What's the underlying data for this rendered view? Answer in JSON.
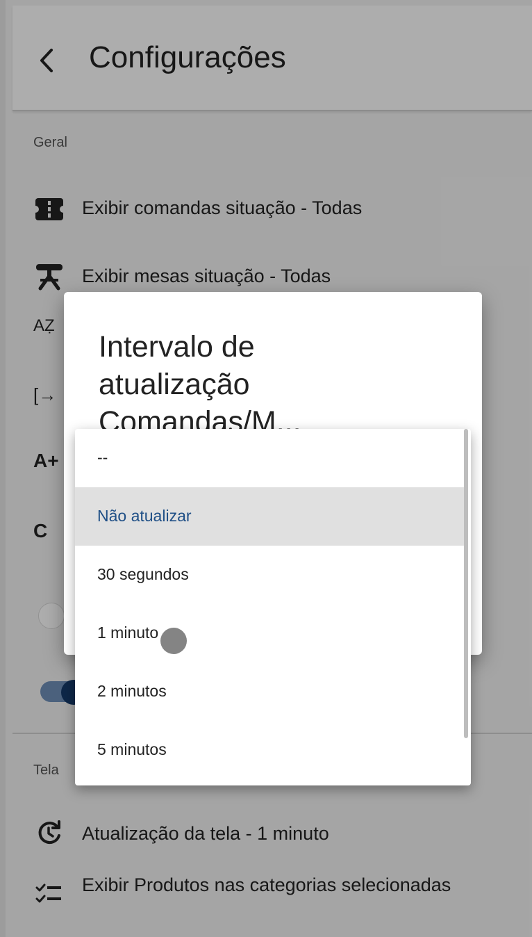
{
  "header": {
    "title": "Configurações"
  },
  "sections": {
    "geral": {
      "label": "Geral",
      "items": [
        {
          "icon": "ticket-icon",
          "label": "Exibir comandas situação - Todas"
        },
        {
          "icon": "table-icon",
          "label": "Exibir mesas situação - Todas"
        }
      ],
      "partially_hidden": {
        "sort_icon_text": "AẒ",
        "logout_icon_text": "[→",
        "font_icon_text": "A+",
        "refresh_icon_text": "C"
      }
    },
    "tela": {
      "label": "Tela",
      "items": [
        {
          "icon": "refresh-icon",
          "label": "Atualização da tela - 1 minuto"
        },
        {
          "icon": "checklist-icon",
          "label": "Exibir Produtos nas categorias selecionadas"
        }
      ]
    }
  },
  "dialog": {
    "title": "Intervalo de atualização Comandas/M..."
  },
  "dropdown": {
    "options": [
      {
        "label": "--",
        "selected": false
      },
      {
        "label": "Não atualizar",
        "selected": true
      },
      {
        "label": "30 segundos",
        "selected": false
      },
      {
        "label": "1 minuto",
        "selected": false
      },
      {
        "label": "2 minutos",
        "selected": false
      },
      {
        "label": "5 minutos",
        "selected": false
      }
    ]
  },
  "colors": {
    "accent": "#1f4f86",
    "toggle_track": "#6f8fb8",
    "toggle_knob": "#163a6b",
    "selected_bg": "#e0e0e0"
  }
}
